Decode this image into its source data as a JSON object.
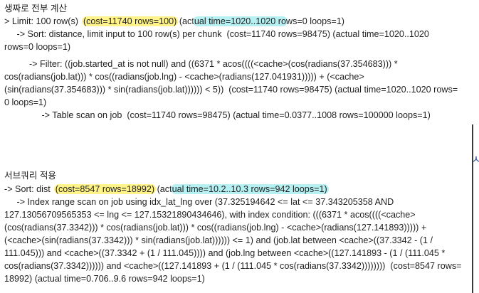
{
  "section1": {
    "title": "생짜로 전부 계산",
    "l1": {
      "pre": "> Limit: 100 row(s)  ",
      "hl_y": "(cost=11740 rows=100)",
      "mid": " (act",
      "hl_c": "ual time=1020..1020 ro",
      "post": "ws=0 loops=1)"
    },
    "l2": "     -> Sort: distance, limit input to 100 row(s) per chunk  (cost=11740 rows=98475) (actual time=1020..1020",
    "l3": "rows=0 loops=1)",
    "l4": "          -> Filter: ((job.started_at is not null) and ((6371 * acos((((<cache>(cos(radians(37.354683))) *",
    "l5": "cos(radians(job.lat))) * cos((radians(job.lng) - <cache>(radians(127.041931))))) + (<cache>",
    "l6": "(sin(radians(37.354683))) * sin(radians(job.lat)))))) < 5))  (cost=11740 rows=98475) (actual time=1020..1020 rows=",
    "l7": "0 loops=1)",
    "l8": "               -> Table scan on job  (cost=11740 rows=98475) (actual time=0.0377..1008 rows=100000 loops=1)"
  },
  "section2": {
    "title": "서브쿼리 적용",
    "l1": {
      "pre": "-> Sort: dist  ",
      "hl_y": "(cost=8547 rows=18992)",
      "mid": " (act",
      "hl_c": "ual time=10.2..10.3 rows=942 loops=1)",
      "post": ""
    },
    "l2": "     -> Index range scan on job using idx_lat_lng over (37.325194642 <= lat <= 37.343205358 AND",
    "l3": "127.13056709565353 <= lng <= 127.15321890434646), with index condition: (((6371 * acos((((<cache>",
    "l4": "(cos(radians(37.3342))) * cos(radians(job.lat))) * cos((radians(job.lng) - <cache>(radians(127.141893))))) +",
    "l5": "(<cache>(sin(radians(37.3342))) * sin(radians(job.lat)))))) <= 1) and (job.lat between <cache>((37.3342 - (1 /",
    "l6": "111.045))) and <cache>((37.3342 + (1 / 111.045)))) and (job.lng between <cache>((127.141893 - (1 / (111.045 *",
    "l7": "cos(radians(37.3342)))))) and <cache>((127.141893 + (1 / (111.045 * cos(radians(37.3342))))))))  (cost=8547 rows=",
    "l8": "18992) (actual time=0.706..9.6 rows=942 loops=1)"
  },
  "edge_glyph": "ㅅ"
}
